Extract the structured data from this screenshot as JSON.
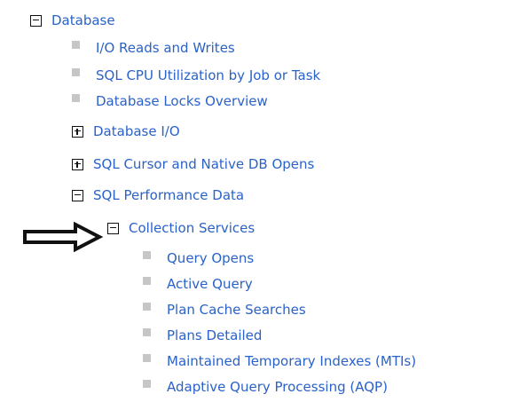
{
  "tree": {
    "database": {
      "label": "Database",
      "state": "expanded"
    },
    "database_children": [
      {
        "label": "I/O Reads and Writes",
        "type": "leaf"
      },
      {
        "label": "SQL CPU Utilization by Job or Task",
        "type": "leaf"
      },
      {
        "label": "Database Locks Overview",
        "type": "leaf"
      },
      {
        "label": "Database I/O",
        "type": "collapsed"
      },
      {
        "label": "SQL Cursor and Native DB Opens",
        "type": "collapsed"
      },
      {
        "label": "SQL Performance Data",
        "type": "expanded"
      }
    ],
    "collection_services": {
      "label": "Collection Services",
      "state": "expanded"
    },
    "collection_children": [
      {
        "label": "Query Opens"
      },
      {
        "label": "Active Query"
      },
      {
        "label": "Plan Cache Searches"
      },
      {
        "label": "Plans Detailed"
      },
      {
        "label": "Maintained Temporary Indexes (MTIs)"
      },
      {
        "label": "Adaptive Query Processing (AQP)"
      }
    ]
  },
  "colors": {
    "link": "#2a62c9",
    "bullet": "#c6c6c6",
    "arrow": "#111111"
  },
  "icons": {
    "expand": "plus-box-icon",
    "collapse": "minus-box-icon",
    "leaf": "square-bullet-icon",
    "pointer": "right-arrow-icon"
  }
}
